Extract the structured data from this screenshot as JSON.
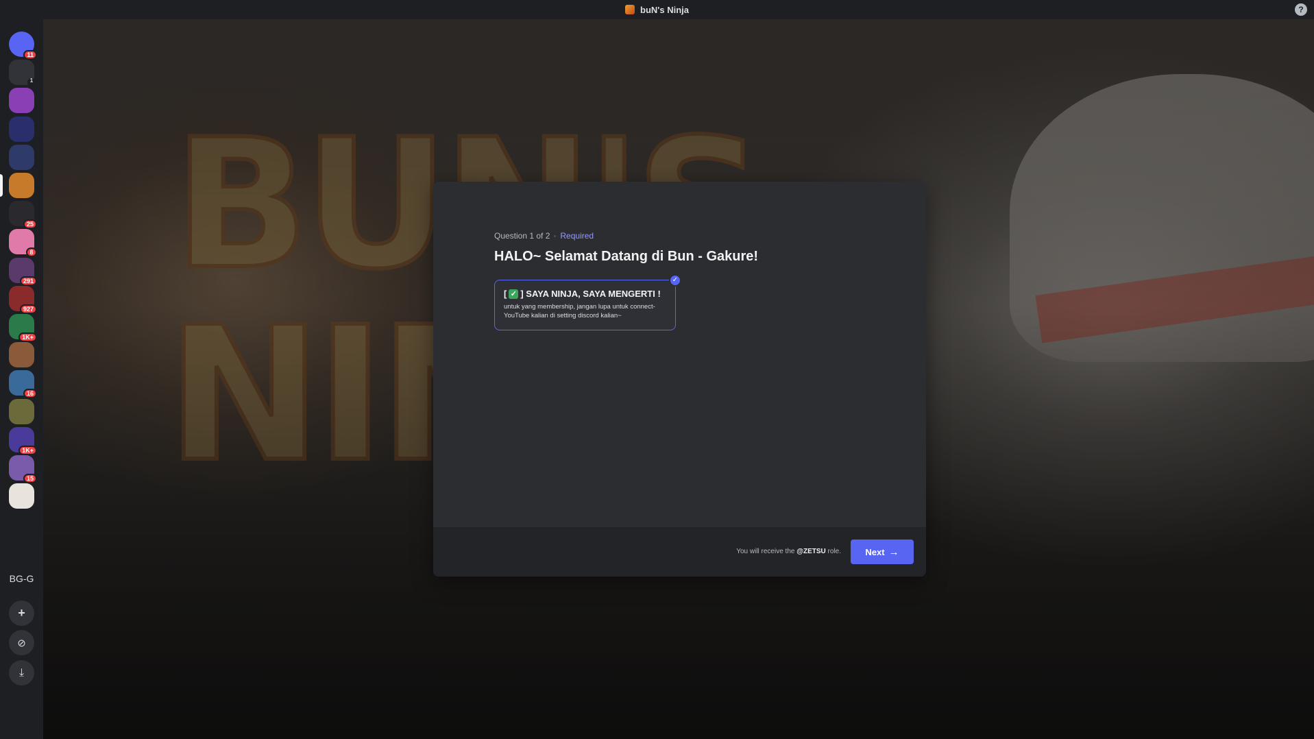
{
  "window": {
    "title": "buN's Ninja",
    "help_icon": "?"
  },
  "sidebar": {
    "servers": [
      {
        "name": "discord-home",
        "badge": "11",
        "color": "#5865f2"
      },
      {
        "name": "notifications",
        "badge": "1",
        "color": "#313338"
      },
      {
        "name": "server-3",
        "badge": "",
        "color": "#8a3fb5"
      },
      {
        "name": "server-4",
        "badge": "",
        "color": "#2a2f6b"
      },
      {
        "name": "server-5",
        "badge": "",
        "color": "#2d3a6a"
      },
      {
        "name": "buns-ninja",
        "badge": "",
        "color": "#c77a2a"
      },
      {
        "name": "server-7",
        "badge": "25",
        "color": "#2a2a2e"
      },
      {
        "name": "server-8",
        "badge": "8",
        "color": "#e07aa8"
      },
      {
        "name": "server-9",
        "badge": "291",
        "color": "#5a3a6a"
      },
      {
        "name": "server-10",
        "badge": "927",
        "color": "#8a2a2a"
      },
      {
        "name": "server-11",
        "badge": "1K+",
        "color": "#2a7a4a"
      },
      {
        "name": "server-12",
        "badge": "",
        "color": "#8a5a3a"
      },
      {
        "name": "server-13",
        "badge": "16",
        "color": "#3a6a9a"
      },
      {
        "name": "server-14",
        "badge": "",
        "color": "#6a6a3a"
      },
      {
        "name": "server-15",
        "badge": "1K+",
        "color": "#4a3a9a"
      },
      {
        "name": "server-16",
        "badge": "15",
        "color": "#7a5aaa"
      },
      {
        "name": "server-17",
        "badge": "",
        "color": "#e8e4dc"
      }
    ],
    "text_server": "BG-G",
    "add_icon": "+",
    "explore_icon": "⊘",
    "download_icon": "⤓"
  },
  "modal": {
    "question_counter": "Question 1 of 2",
    "required_label": "Required",
    "title": "HALO~ Selamat Datang di Bun - Gakure!",
    "option": {
      "prefix": "[",
      "emoji": "✓",
      "label": "] SAYA NINJA, SAYA MENGERTI !",
      "description": "untuk yang membership, jangan lupa untuk connect-YouTube kalian di setting discord kalian~",
      "selected_icon": "✓"
    },
    "footer": {
      "role_prefix": "You will receive the",
      "role_name": "@ZETSU",
      "role_suffix": "role.",
      "next_label": "Next",
      "next_arrow": "→"
    }
  },
  "colors": {
    "accent": "#5865f2",
    "modal_bg": "#2b2d31",
    "footer_bg": "#232428"
  }
}
